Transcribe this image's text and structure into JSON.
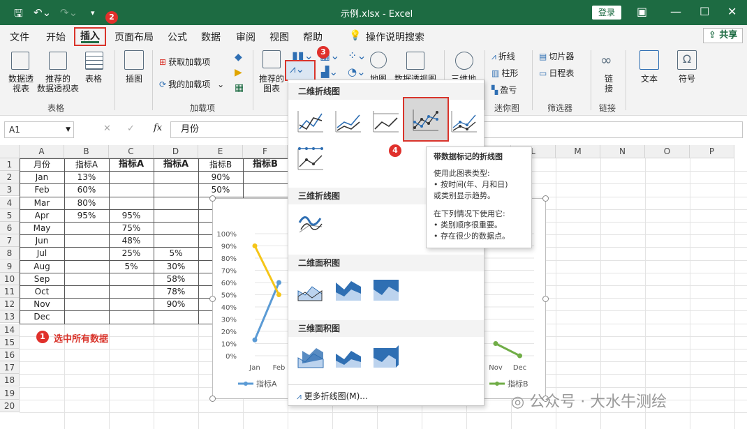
{
  "titlebar": {
    "title": "示例.xlsx - Excel",
    "login": "登录",
    "save_icon": "save-icon",
    "undo_icon": "undo-icon",
    "redo_icon": "redo-icon"
  },
  "menu": {
    "items": [
      "文件",
      "开始",
      "插入",
      "页面布局",
      "公式",
      "数据",
      "审阅",
      "视图",
      "帮助",
      "操作说明搜索"
    ],
    "share": "共享"
  },
  "ribbon": {
    "pivot": "数据透\n视表",
    "recommended_pivot": "推荐的\n数据透视表",
    "table": "表格",
    "group_tables": "表格",
    "illustrations": "插图",
    "get_addins": "获取加载项",
    "my_addins": "我的加载项",
    "group_addins": "加载项",
    "recommended_charts": "推荐的\n图表",
    "maps": "地图",
    "pivot_chart": "数据透视图",
    "three_d_map": "三维地",
    "spark_line": "折线",
    "spark_column": "柱形",
    "spark_winloss": "盈亏",
    "group_sparklines": "迷你图",
    "slicer": "切片器",
    "timeline": "日程表",
    "group_filters": "筛选器",
    "link": "链\n接",
    "group_links": "链接",
    "text": "文本",
    "symbol": "符号"
  },
  "formula": {
    "namebox": "A1",
    "value": "月份"
  },
  "columns": [
    "A",
    "B",
    "C",
    "D",
    "E",
    "F",
    "G",
    "H",
    "I",
    "J",
    "K",
    "L",
    "M",
    "N",
    "O",
    "P"
  ],
  "rows": [
    "1",
    "2",
    "3",
    "4",
    "5",
    "6",
    "7",
    "8",
    "9",
    "10",
    "11",
    "12",
    "13",
    "14",
    "15",
    "16",
    "17",
    "18",
    "19",
    "20"
  ],
  "sheet": {
    "headers": [
      "月份",
      "指标A",
      "指标A",
      "指标A",
      "指标B",
      "指标B"
    ],
    "months": [
      "Jan",
      "Feb",
      "Mar",
      "Apr",
      "May",
      "Jun",
      "Jul",
      "Aug",
      "Sep",
      "Oct",
      "Nov",
      "Dec"
    ],
    "colB": [
      "13%",
      "60%",
      "80%",
      "95%"
    ],
    "colC": [
      "95%",
      "75%",
      "48%",
      "25%",
      "5%"
    ],
    "colD": [
      "5%",
      "30%",
      "58%",
      "78%",
      "90%"
    ],
    "colE": [
      "90%",
      "50%"
    ],
    "note": "选中所有数据"
  },
  "dropdown": {
    "sec_2d_line": "二维折线图",
    "sec_3d_line": "三维折线图",
    "sec_2d_area": "二维面积图",
    "sec_3d_area": "三维面积图",
    "more": "更多折线图(M)..."
  },
  "tooltip": {
    "title": "带数据标记的折线图",
    "l1": "使用此图表类型:",
    "l2": "• 按时间(年、月和日)",
    "l3": "或类别显示趋势。",
    "l4": "在下列情况下使用它:",
    "l5": "• 类别顺序很重要。",
    "l6": "• 存在很少的数据点。"
  },
  "badges": [
    "1",
    "2",
    "3",
    "4"
  ],
  "watermark": "公众号 · 大水牛测绘",
  "chart_data": {
    "type": "line",
    "categories": [
      "Jan",
      "Feb",
      "Nov",
      "Dec"
    ],
    "y_ticks": [
      "0%",
      "10%",
      "20%",
      "30%",
      "40%",
      "50%",
      "60%",
      "70%",
      "80%",
      "90%",
      "100%"
    ],
    "ylim": [
      0,
      1
    ],
    "series": [
      {
        "name": "指标A",
        "color": "#5b9bd5",
        "points": [
          [
            0,
            0.13
          ],
          [
            1,
            0.6
          ]
        ]
      },
      {
        "color": "#f5c518",
        "points": [
          [
            0,
            0.9
          ],
          [
            1,
            0.5
          ]
        ]
      },
      {
        "name": "指标B",
        "color": "#70ad47",
        "points": [
          [
            2,
            0.1
          ],
          [
            3,
            0.0
          ]
        ]
      }
    ],
    "legend": [
      "指标A",
      "指标B"
    ]
  },
  "colors": {
    "excel_green": "#1d6b42",
    "highlight_red": "#d9342b"
  }
}
